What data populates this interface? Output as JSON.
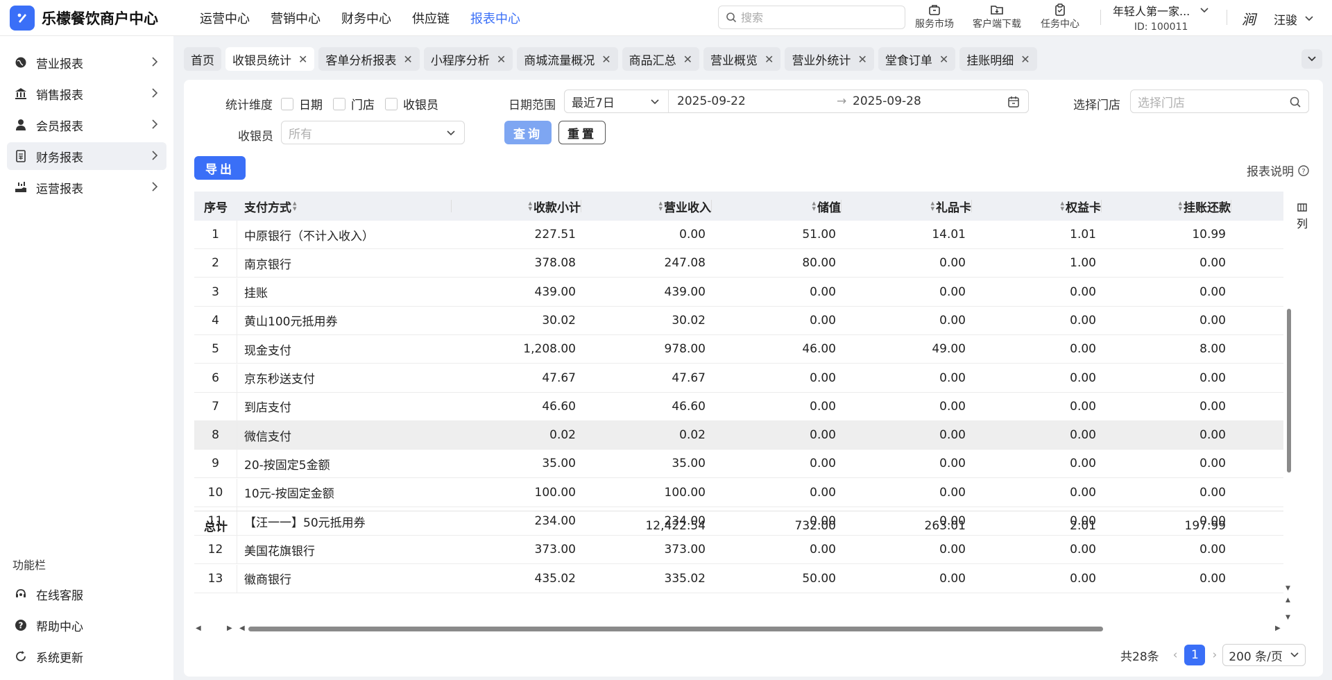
{
  "app": {
    "title": "乐檬餐饮商户中心",
    "nav": [
      "运营中心",
      "营销中心",
      "财务中心",
      "供应链",
      "报表中心"
    ],
    "active_nav": 4,
    "search_placeholder": "搜索",
    "tools": [
      "服务市场",
      "客户端下载",
      "任务中心"
    ],
    "store_name": "年轻人第一家...",
    "store_id": "ID: 100011",
    "user_name": "汪骏",
    "avatar_text": "涧"
  },
  "sidebar": {
    "items": [
      {
        "label": "营业报表",
        "icon": "globe-icon"
      },
      {
        "label": "销售报表",
        "icon": "bank-icon"
      },
      {
        "label": "会员报表",
        "icon": "user-icon"
      },
      {
        "label": "财务报表",
        "icon": "ledger-icon"
      },
      {
        "label": "运营报表",
        "icon": "chart-hand-icon"
      }
    ],
    "active_item": 3,
    "func_title": "功能栏",
    "func_items": [
      {
        "label": "在线客服",
        "icon": "headset-icon"
      },
      {
        "label": "帮助中心",
        "icon": "help-icon"
      },
      {
        "label": "系统更新",
        "icon": "refresh-icon"
      }
    ]
  },
  "tabs": [
    "首页",
    "收银员统计",
    "客单分析报表",
    "小程序分析",
    "商城流量概况",
    "商品汇总",
    "营业概览",
    "营业外统计",
    "堂食订单",
    "挂账明细"
  ],
  "active_tab": 1,
  "filters": {
    "dimension_label": "统计维度",
    "dimension_options": [
      "日期",
      "门店",
      "收银员"
    ],
    "date_range_label": "日期范围",
    "date_preset": "最近7日",
    "date_start": "2025-09-22",
    "date_end": "2025-09-28",
    "store_label": "选择门店",
    "store_placeholder": "选择门店",
    "cashier_label": "收银员",
    "cashier_placeholder": "所有",
    "query_button": "查询",
    "reset_button": "重置",
    "export_button": "导出",
    "report_note": "报表说明"
  },
  "table": {
    "columns": [
      "序号",
      "支付方式",
      "收款小计",
      "营业收入",
      "储值",
      "礼品卡",
      "权益卡",
      "挂账还款"
    ],
    "rows": [
      [
        "1",
        "中原银行（不计入收入）",
        "227.51",
        "0.00",
        "51.00",
        "14.01",
        "1.01",
        "10.99"
      ],
      [
        "2",
        "南京银行",
        "378.08",
        "247.08",
        "80.00",
        "0.00",
        "1.00",
        "0.00"
      ],
      [
        "3",
        "挂账",
        "439.00",
        "439.00",
        "0.00",
        "0.00",
        "0.00",
        "0.00"
      ],
      [
        "4",
        "黄山100元抵用券",
        "30.02",
        "30.02",
        "0.00",
        "0.00",
        "0.00",
        "0.00"
      ],
      [
        "5",
        "现金支付",
        "1,208.00",
        "978.00",
        "46.00",
        "49.00",
        "0.00",
        "8.00"
      ],
      [
        "6",
        "京东秒送支付",
        "47.67",
        "47.67",
        "0.00",
        "0.00",
        "0.00",
        "0.00"
      ],
      [
        "7",
        "到店支付",
        "46.60",
        "46.60",
        "0.00",
        "0.00",
        "0.00",
        "0.00"
      ],
      [
        "8",
        "微信支付",
        "0.02",
        "0.02",
        "0.00",
        "0.00",
        "0.00",
        "0.00"
      ],
      [
        "9",
        "20-按固定5金额",
        "35.00",
        "35.00",
        "0.00",
        "0.00",
        "0.00",
        "0.00"
      ],
      [
        "10",
        "10元-按固定金额",
        "100.00",
        "100.00",
        "0.00",
        "0.00",
        "0.00",
        "0.00"
      ],
      [
        "11",
        "【汪一一】50元抵用券",
        "234.00",
        "234.00",
        "0.00",
        "0.00",
        "0.00",
        "0.00"
      ],
      [
        "12",
        "美国花旗银行",
        "373.00",
        "373.00",
        "0.00",
        "0.00",
        "0.00",
        "0.00"
      ],
      [
        "13",
        "徽商银行",
        "435.02",
        "335.02",
        "50.00",
        "0.00",
        "0.00",
        "0.00"
      ]
    ],
    "highlight_row": 7,
    "total_label": "总计",
    "totals": [
      "",
      "12,422.54",
      "732.00",
      "263.01",
      "2.01",
      "197.99"
    ],
    "col_toggle": "列"
  },
  "pagination": {
    "total_text": "共28条",
    "current_page": "1",
    "page_size": "200 条/页"
  },
  "colors": {
    "primary": "#3a6ff7",
    "primary_light": "#7ea6f2",
    "page_bg": "#f0f2f5"
  }
}
